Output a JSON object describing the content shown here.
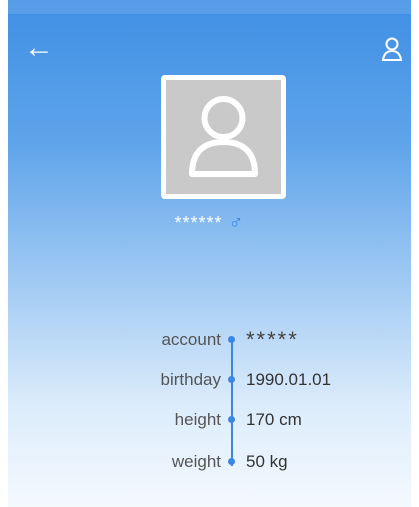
{
  "header": {
    "back_icon": "arrow-left-icon",
    "profile_icon": "person-icon"
  },
  "profile": {
    "avatar_icon": "user-avatar-icon",
    "name": "******",
    "gender_symbol": "♂"
  },
  "info": [
    {
      "label": "account",
      "value": "*****"
    },
    {
      "label": "birthday",
      "value": "1990.01.01"
    },
    {
      "label": "height",
      "value": "170 cm"
    },
    {
      "label": "weight",
      "value": "50 kg"
    }
  ],
  "colors": {
    "accent": "#3a86e0",
    "gradient_top": "#3f8fe4",
    "gradient_bottom": "#f4f9fe"
  }
}
